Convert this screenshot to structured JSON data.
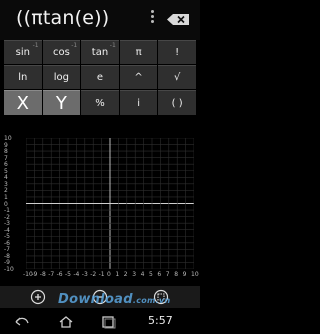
{
  "display": {
    "expression": "((πtan(e))"
  },
  "keypad": {
    "row1": [
      {
        "label": "sin",
        "sup": "-1"
      },
      {
        "label": "cos",
        "sup": "-1"
      },
      {
        "label": "tan",
        "sup": "-1"
      },
      {
        "label": "π",
        "sup": ""
      },
      {
        "label": "!",
        "sup": ""
      }
    ],
    "row2": [
      {
        "label": "ln",
        "sup": ""
      },
      {
        "label": "log",
        "sup": ""
      },
      {
        "label": "e",
        "sup": ""
      },
      {
        "label": "^",
        "sup": ""
      },
      {
        "label": "√",
        "sup": ""
      }
    ],
    "row3": [
      {
        "label": "X"
      },
      {
        "label": "Y"
      },
      {
        "label": "%"
      },
      {
        "label": "i"
      },
      {
        "label": "( )"
      }
    ]
  },
  "graph": {
    "y_ticks": [
      "10",
      "9",
      "8",
      "7",
      "6",
      "5",
      "4",
      "3",
      "2",
      "1",
      "0",
      "-1",
      "-2",
      "-3",
      "-4",
      "-5",
      "-6",
      "-7",
      "-8",
      "-9",
      "-10"
    ],
    "x_ticks": [
      "-10",
      "-9",
      "-8",
      "-7",
      "-6",
      "-5",
      "-4",
      "-3",
      "-2",
      "-1",
      "0",
      "1",
      "2",
      "3",
      "4",
      "5",
      "6",
      "7",
      "8",
      "9",
      "10"
    ]
  },
  "watermark": {
    "text": "Download",
    "suffix": ".com.vn"
  },
  "status": {
    "time": "5:57"
  },
  "colors": {
    "background": "#000000",
    "key": "#2f2f2f",
    "var_key": "#6c6c6c",
    "grid": "#2e2e2e",
    "axis": "#cfcfcf",
    "watermark": "#5aa4dc"
  },
  "icons": {
    "overflow": "overflow-menu-icon",
    "backspace": "backspace-icon",
    "zoom_in": "zoom-in-icon",
    "zoom_out": "zoom-out-icon",
    "zoom_reset": "zoom-reset-icon",
    "nav_back": "back-icon",
    "nav_home": "home-icon",
    "nav_recent": "recent-apps-icon"
  }
}
